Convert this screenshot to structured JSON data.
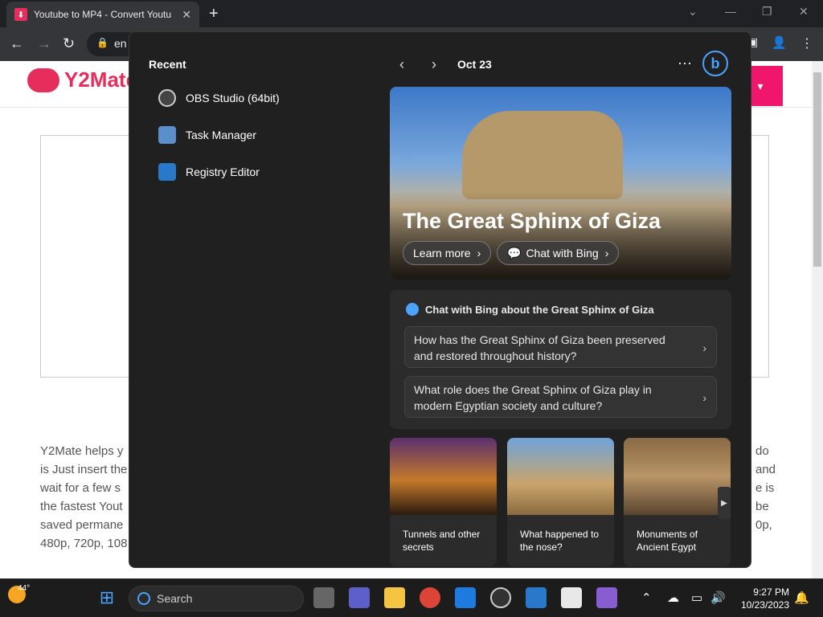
{
  "browser": {
    "tab_title": "Youtube to MP4 - Convert Youtu",
    "new_tab": "+",
    "url_fragment": "en"
  },
  "page": {
    "logo": "Y2Mate",
    "paragraph_lines": [
      {
        "left": "Y2Mate helps y",
        "right": "do"
      },
      {
        "left": "is Just insert the",
        "right": "and"
      },
      {
        "left": "wait for a few s",
        "right": "e is"
      },
      {
        "left": "the fastest Yout",
        "right": "be"
      },
      {
        "left": "saved permane",
        "right": "0p,"
      },
      {
        "left": "480p, 720p, 108",
        "right": ""
      }
    ]
  },
  "panel": {
    "recent_heading": "Recent",
    "recent_items": [
      {
        "label": "OBS Studio (64bit)",
        "color": "#444444"
      },
      {
        "label": "Task Manager",
        "color": "#5b8fc9"
      },
      {
        "label": "Registry Editor",
        "color": "#2a78c9"
      }
    ],
    "date": "Oct 23",
    "hero_title": "The Great Sphinx of Giza",
    "learn_more": "Learn more",
    "chat_with_bing": "Chat with Bing",
    "chat_heading": "Chat with Bing about the Great Sphinx of Giza",
    "questions": [
      "How has the Great Sphinx of Giza been preserved and restored throughout history?",
      "What role does the Great Sphinx of Giza play in modern Egyptian society and culture?"
    ],
    "cards": [
      {
        "label": "Tunnels and other secrets"
      },
      {
        "label": "What happened to the nose?"
      },
      {
        "label": "Monuments of Ancient Egypt"
      }
    ]
  },
  "taskbar": {
    "weather": "44°",
    "search_placeholder": "Search",
    "time": "9:27 PM",
    "date": "10/23/2023"
  }
}
